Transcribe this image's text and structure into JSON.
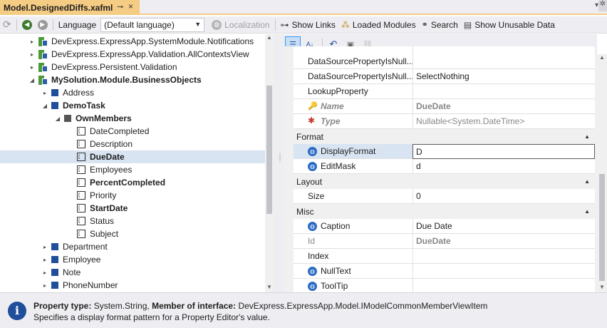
{
  "tab": {
    "title": "Model.DesignedDiffs.xafml",
    "pin": "⊸",
    "close": "×",
    "overflow": "▾",
    "gear": "✲"
  },
  "toolbar": {
    "language_label": "Language",
    "language_value": "(Default language)",
    "localization": "Localization",
    "show_links": "Show Links",
    "loaded_modules": "Loaded Modules",
    "search": "Search",
    "show_unusable": "Show Unusable Data"
  },
  "tree": {
    "rows": [
      {
        "text": "DevExpress.ExpressApp.SystemModule.Notifications",
        "expander": "▸"
      },
      {
        "text": "DevExpress.ExpressApp.Validation.AllContextsView",
        "expander": "▸"
      },
      {
        "text": "DevExpress.Persistent.Validation",
        "expander": "▸"
      },
      {
        "text": "MySolution.Module.BusinessObjects",
        "expander": "◢"
      },
      {
        "text": "Address",
        "expander": "▸"
      },
      {
        "text": "DemoTask",
        "expander": "◢"
      },
      {
        "text": "OwnMembers",
        "expander": "◢"
      },
      {
        "text": "DateCompleted"
      },
      {
        "text": "Description"
      },
      {
        "text": "DueDate"
      },
      {
        "text": "Employees"
      },
      {
        "text": "PercentCompleted"
      },
      {
        "text": "Priority"
      },
      {
        "text": "StartDate"
      },
      {
        "text": "Status"
      },
      {
        "text": "Subject"
      },
      {
        "text": "Department",
        "expander": "▸"
      },
      {
        "text": "Employee",
        "expander": "▸"
      },
      {
        "text": "Note",
        "expander": "▸"
      },
      {
        "text": "PhoneNumber",
        "expander": "▸"
      }
    ]
  },
  "grid": {
    "rows": [
      {
        "name": "DataSourcePropertyIsNull...",
        "value": ""
      },
      {
        "name": "DataSourcePropertyIsNull...",
        "value": "SelectNothing"
      },
      {
        "name": "LookupProperty",
        "value": ""
      },
      {
        "name": "Name",
        "value": "DueDate"
      },
      {
        "name": "Type",
        "value": "Nullable<System.DateTime>"
      }
    ],
    "format_category": "Format",
    "display_format": {
      "name": "DisplayFormat",
      "value": "D"
    },
    "edit_mask": {
      "name": "EditMask",
      "value": "d"
    },
    "layout_category": "Layout",
    "size": {
      "name": "Size",
      "value": "0"
    },
    "misc_category": "Misc",
    "caption": {
      "name": "Caption",
      "value": "Due Date"
    },
    "id": {
      "name": "Id",
      "value": "DueDate"
    },
    "index": {
      "name": "Index",
      "value": ""
    },
    "null_text": {
      "name": "NullText",
      "value": ""
    },
    "tooltip": {
      "name": "ToolTip",
      "value": ""
    }
  },
  "info": {
    "icon": "i",
    "type_label": "Property type:",
    "type_value": "System.String,",
    "member_label": "Member of interface:",
    "member_value": "DevExpress.ExpressApp.Model.IModelCommonMemberViewItem",
    "description": "Specifies a display format pattern for a Property Editor's value."
  }
}
